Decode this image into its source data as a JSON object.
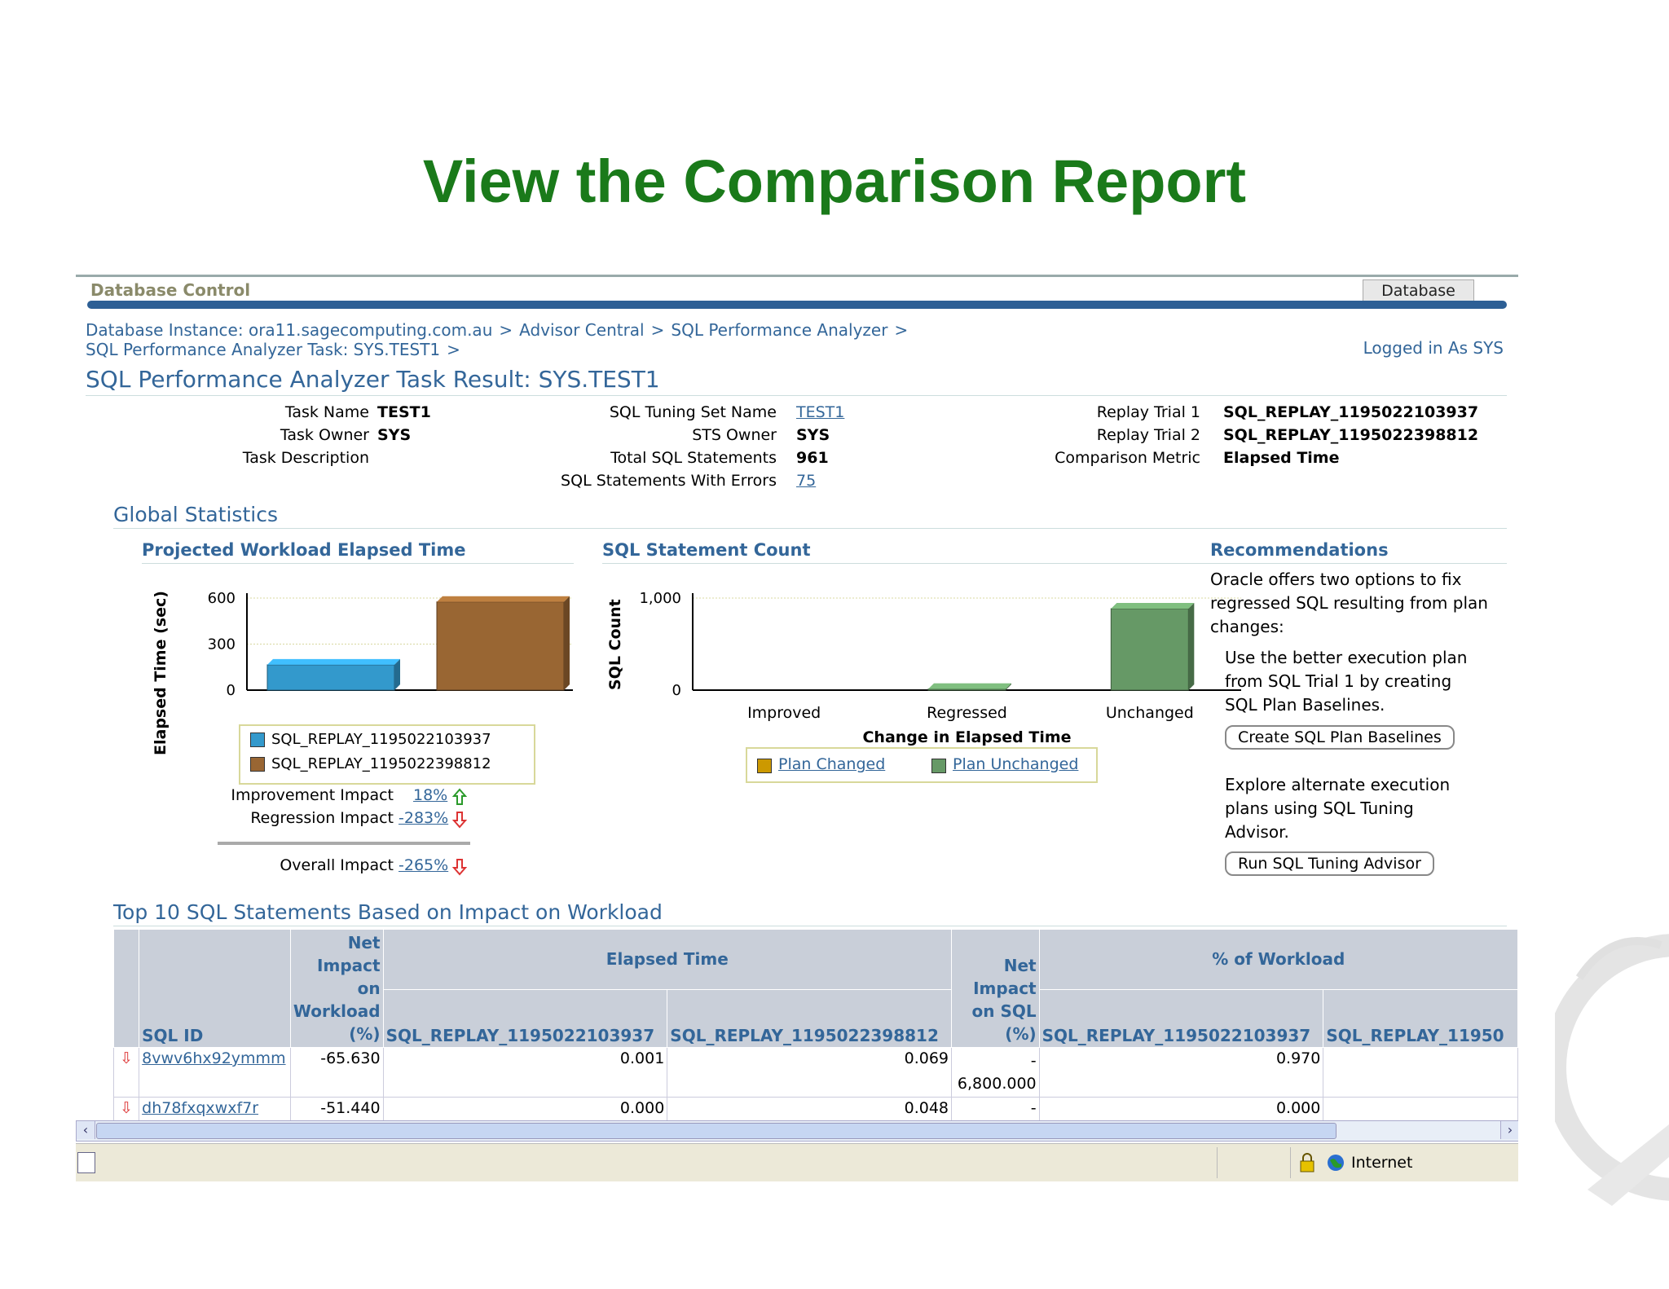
{
  "slide_title": "View the Comparison Report",
  "brand": "Database Control",
  "top_tab": "Database",
  "breadcrumb": {
    "line1": [
      "Database Instance: ora11.sagecomputing.com.au",
      "Advisor Central",
      "SQL Performance Analyzer"
    ],
    "line2": "SQL Performance Analyzer Task: SYS.TEST1",
    "sep": ">"
  },
  "logged_in": "Logged in As SYS",
  "page_title": "SQL Performance Analyzer Task Result: SYS.TEST1",
  "task": {
    "name_label": "Task Name",
    "name": "TEST1",
    "owner_label": "Task Owner",
    "owner": "SYS",
    "desc_label": "Task Description",
    "sts_name_label": "SQL Tuning Set Name",
    "sts_name": "TEST1",
    "sts_owner_label": "STS Owner",
    "sts_owner": "SYS",
    "total_label": "Total SQL Statements",
    "total": "961",
    "errors_label": "SQL Statements With Errors",
    "errors": "75",
    "trial1_label": "Replay Trial 1",
    "trial1": "SQL_REPLAY_1195022103937",
    "trial2_label": "Replay Trial 2",
    "trial2": "SQL_REPLAY_1195022398812",
    "metric_label": "Comparison Metric",
    "metric": "Elapsed Time"
  },
  "global_stats_title": "Global Statistics",
  "chart_data": [
    {
      "type": "bar",
      "title": "Projected Workload Elapsed Time",
      "ylabel": "Elapsed Time (sec)",
      "xlabel": "",
      "ylim": [
        0,
        600
      ],
      "yticks": [
        "0",
        "300",
        "600"
      ],
      "grid": true,
      "legend": "bottom",
      "series": [
        {
          "name": "SQL_REPLAY_1195022103937",
          "color": "#3399cc",
          "values": [
            165
          ]
        },
        {
          "name": "SQL_REPLAY_1195022398812",
          "color": "#996633",
          "values": [
            575
          ]
        }
      ]
    },
    {
      "type": "bar",
      "title": "SQL Statement Count",
      "ylabel": "SQL Count",
      "xlabel": "Change in Elapsed Time",
      "ylim": [
        0,
        1000
      ],
      "yticks": [
        "0",
        "1,000"
      ],
      "grid": true,
      "legend": "bottom",
      "categories": [
        "Improved",
        "Regressed",
        "Unchanged"
      ],
      "series": [
        {
          "name": "Plan Changed",
          "color": "#cc9900",
          "values": [
            0,
            0,
            0
          ]
        },
        {
          "name": "Plan Unchanged",
          "color": "#669966",
          "values": [
            0,
            12,
            885
          ]
        }
      ]
    }
  ],
  "impact": {
    "improvement_label": "Improvement Impact",
    "improvement": "18%",
    "regression_label": "Regression Impact",
    "regression": "-283%",
    "overall_label": "Overall Impact",
    "overall": "-265%"
  },
  "recommendations": {
    "title": "Recommendations",
    "intro": [
      "Oracle offers two options to fix",
      "regressed SQL resulting from plan",
      "changes:"
    ],
    "opt1": [
      "Use the better execution plan",
      "from SQL Trial 1 by creating",
      "SQL Plan Baselines."
    ],
    "btn1": "Create SQL Plan Baselines",
    "opt2": [
      "Explore alternate execution",
      "plans using SQL Tuning",
      "Advisor."
    ],
    "btn2": "Run SQL Tuning Advisor"
  },
  "top10": {
    "title": "Top 10 SQL Statements Based on Impact on Workload",
    "headers": {
      "sql_id": "SQL ID",
      "net_impact_workload": [
        "Net",
        "Impact",
        "on",
        "Workload",
        "(%)"
      ],
      "elapsed": "Elapsed Time",
      "net_impact_sql": [
        "Net",
        "Impact",
        "on SQL",
        "(%)"
      ],
      "pct_workload": "% of Workload",
      "trial1": "SQL_REPLAY_1195022103937",
      "trial2": "SQL_REPLAY_1195022398812",
      "trial2_cut": "SQL_REPLAY_11950"
    },
    "rows": [
      {
        "sql_id": "8vwv6hx92ymmm",
        "net_workload": "-65.630",
        "el1": "0.001",
        "el2": "0.069",
        "net_sql_a": "-",
        "net_sql_b": "6,800.000",
        "pct1": "0.970",
        "pct2": ""
      },
      {
        "sql_id": "dh78fxqxwxf7r",
        "net_workload": "-51.440",
        "el1": "0.000",
        "el2": "0.048",
        "net_sql_a": "-",
        "net_sql_b": "",
        "pct1": "0.000",
        "pct2": ""
      }
    ]
  },
  "status": {
    "zone": "Internet"
  }
}
